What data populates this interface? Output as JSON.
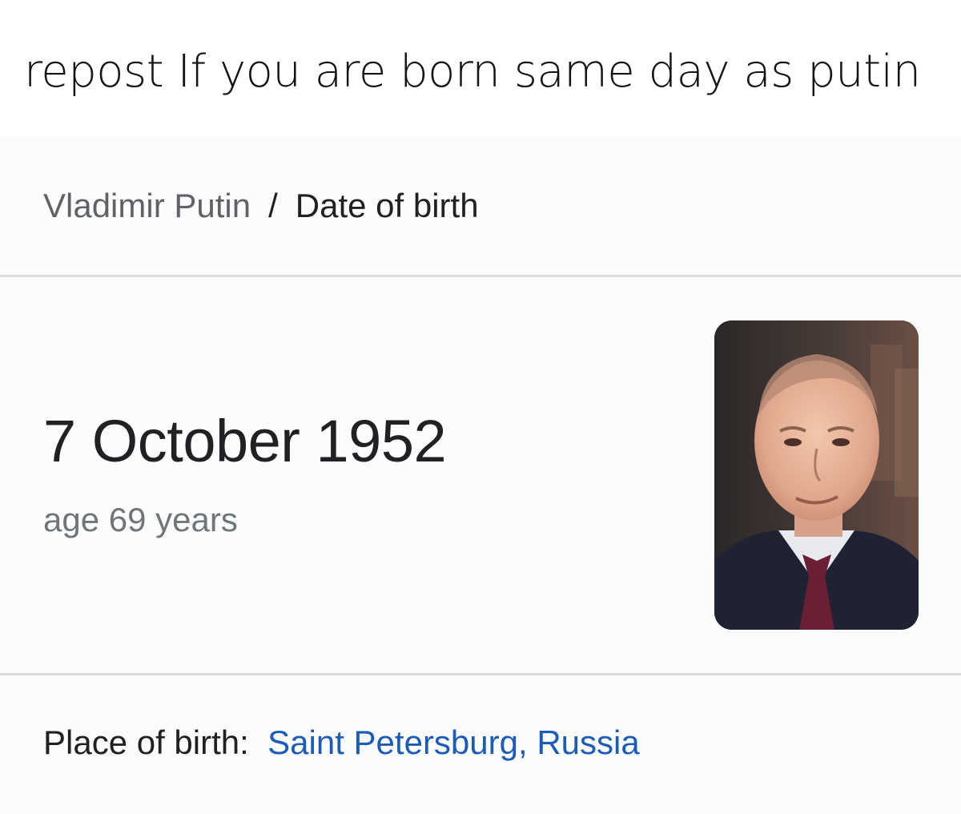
{
  "caption": "repost If you are born same day as putin",
  "breadcrumb": {
    "parent": "Vladimir Putin",
    "separator": "/",
    "current": "Date of birth"
  },
  "answer": {
    "date": "7 October 1952",
    "age": "age 69 years"
  },
  "photo": {
    "icon": "person-portrait-icon"
  },
  "place_of_birth": {
    "label": "Place of birth:",
    "value": "Saint Petersburg, Russia"
  },
  "colors": {
    "link": "#1a5cb8",
    "primary_text": "#202124",
    "secondary_text": "#70757a",
    "divider": "#dadce0"
  }
}
